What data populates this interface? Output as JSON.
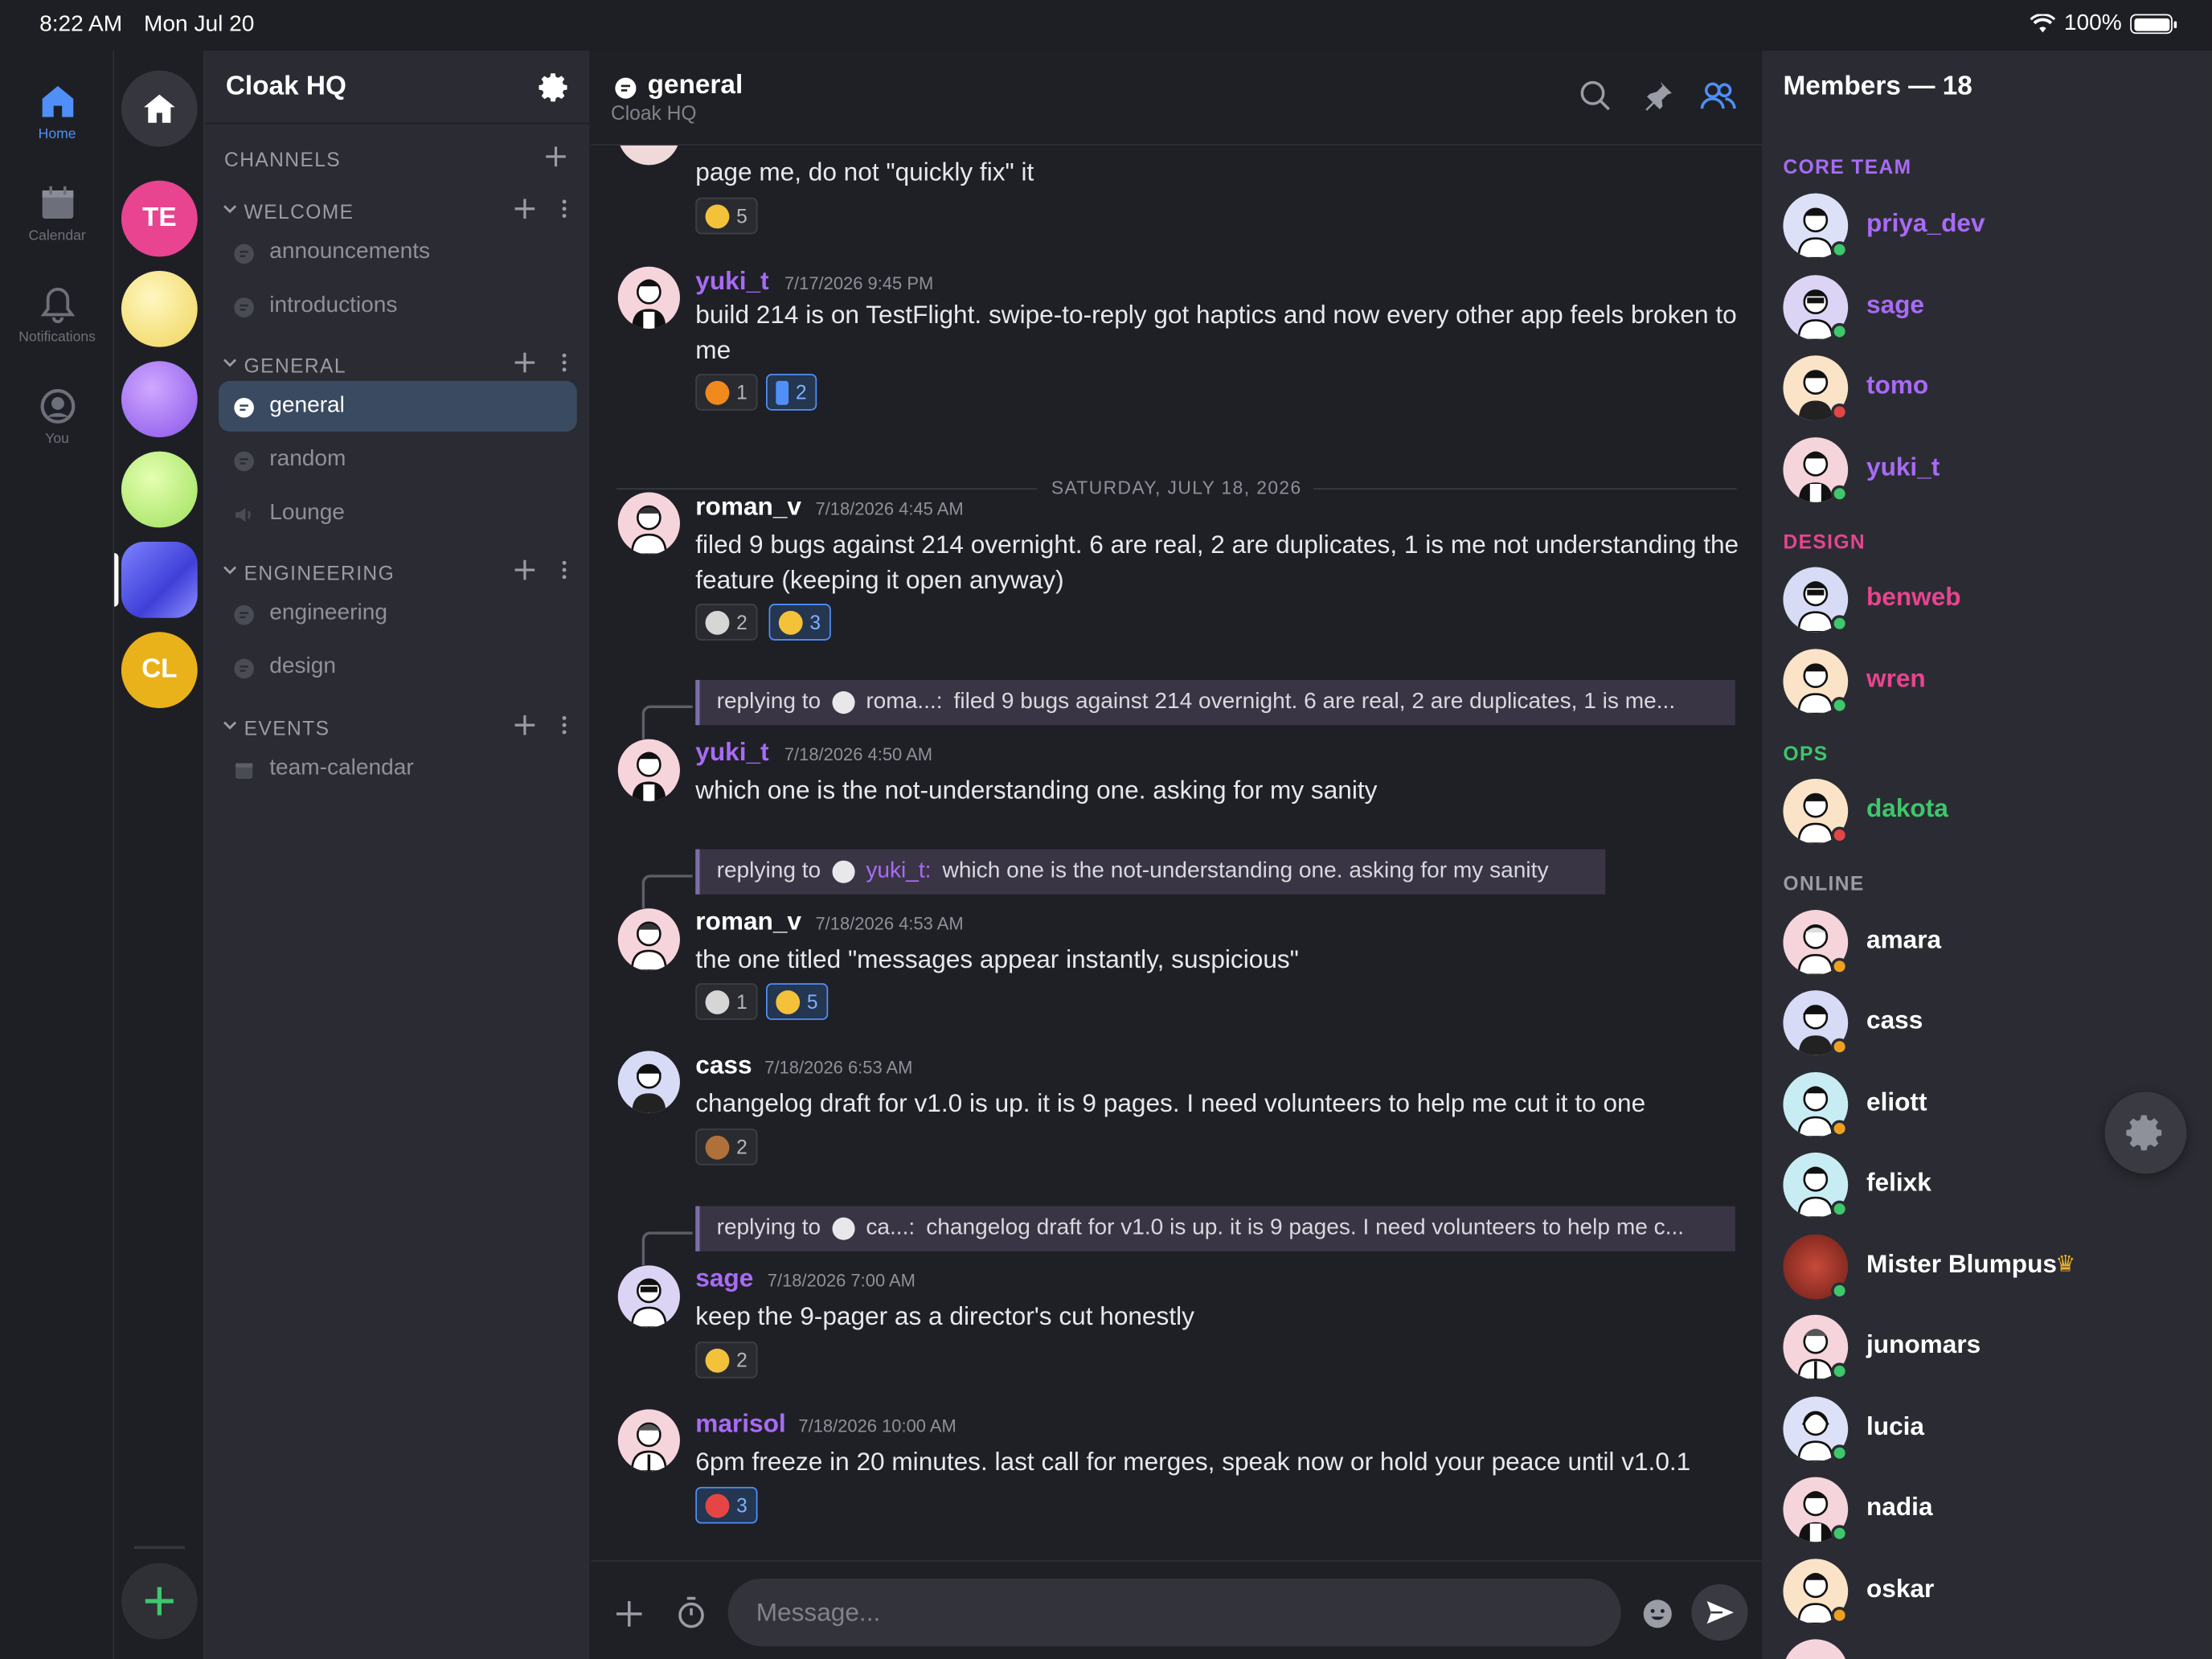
{
  "status_bar": {
    "time": "8:22 AM",
    "date": "Mon Jul 20",
    "battery": "100%"
  },
  "nav_rail": [
    {
      "label": "Home",
      "icon": "home-icon",
      "active": true
    },
    {
      "label": "Calendar",
      "icon": "calendar-icon",
      "active": false
    },
    {
      "label": "Notifications",
      "icon": "bell-icon",
      "active": false
    },
    {
      "label": "You",
      "icon": "user-circle-icon",
      "active": false
    }
  ],
  "servers": [
    {
      "initials": "TE",
      "color": "#e8448f"
    },
    {
      "initials": "",
      "color": "#f3e07a"
    },
    {
      "initials": "",
      "color": "#9b6cf0"
    },
    {
      "initials": "",
      "color": "#b9ec7b"
    },
    {
      "initials": "",
      "color": "#5a5cf0",
      "selected": true
    },
    {
      "initials": "CL",
      "color": "#e9b21a"
    }
  ],
  "sidebar": {
    "server_name": "Cloak HQ",
    "channels_label": "CHANNELS",
    "sections": [
      {
        "name": "WELCOME",
        "channels": [
          "announcements",
          "introductions"
        ]
      },
      {
        "name": "GENERAL",
        "channels": [
          "general",
          "random",
          "Lounge"
        ]
      },
      {
        "name": "ENGINEERING",
        "channels": [
          "engineering",
          "design"
        ]
      },
      {
        "name": "EVENTS",
        "channels": [
          "team-calendar"
        ]
      }
    ],
    "selected_channel": "general"
  },
  "chat": {
    "title": "general",
    "subtitle": "Cloak HQ",
    "partial_message": "page me, do not \"quickly fix\" it",
    "partial_reaction_count": "5",
    "date_divider": "SATURDAY, JULY 18, 2026",
    "messages": [
      {
        "author": "yuki_t",
        "timestamp": "7/17/2026 9:45 PM",
        "text": "build 214 is on TestFlight. swipe-to-reply got haptics and now every other app feels broken to me",
        "reactions": [
          "1",
          "2"
        ]
      },
      {
        "author": "roman_v",
        "timestamp": "7/18/2026 4:45 AM",
        "text": "filed 9 bugs against 214 overnight. 6 are real, 2 are duplicates, 1 is me not understanding the feature (keeping it open anyway)",
        "reactions": [
          "2",
          "3"
        ]
      },
      {
        "author": "yuki_t",
        "timestamp": "7/18/2026 4:50 AM",
        "text": "which one is the not-understanding one. asking for my sanity",
        "reply_prefix": "replying to",
        "reply_author": "roma...:",
        "reply_text": "filed 9 bugs against 214 overnight. 6 are real, 2 are duplicates, 1 is me..."
      },
      {
        "author": "roman_v",
        "timestamp": "7/18/2026 4:53 AM",
        "text": "the one titled \"messages appear instantly, suspicious\"",
        "reply_prefix": "replying to",
        "reply_author": "yuki_t:",
        "reply_text": "which one is the not-understanding one. asking for my sanity",
        "reactions": [
          "1",
          "5"
        ]
      },
      {
        "author": "cass",
        "timestamp": "7/18/2026 6:53 AM",
        "text": "changelog draft for v1.0 is up. it is 9 pages. I need volunteers to help me cut it to one",
        "reactions": [
          "2"
        ]
      },
      {
        "author": "sage",
        "timestamp": "7/18/2026 7:00 AM",
        "text": "keep the 9-pager as a director's cut honestly",
        "reply_prefix": "replying to",
        "reply_author": "ca...:",
        "reply_text": "changelog draft for v1.0 is up. it is 9 pages. I need volunteers to help me c...",
        "reactions": [
          "2"
        ]
      },
      {
        "author": "marisol",
        "timestamp": "7/18/2026 10:00 AM",
        "text": "6pm freeze in 20 minutes. last call for merges, speak now or hold your peace until v1.0.1",
        "reactions": [
          "3"
        ]
      }
    ],
    "composer_placeholder": "Message..."
  },
  "members": {
    "title": "Members — 18",
    "groups": [
      {
        "name": "CORE TEAM",
        "color": "#a86bf5",
        "members": [
          "priya_dev",
          "sage",
          "tomo",
          "yuki_t"
        ]
      },
      {
        "name": "DESIGN",
        "color": "#e8448f",
        "members": [
          "benweb",
          "wren"
        ]
      },
      {
        "name": "OPS",
        "color": "#3ec76b",
        "members": [
          "dakota"
        ]
      },
      {
        "name": "ONLINE",
        "color": "#9a9ca6",
        "members": [
          "amara",
          "cass",
          "eliott",
          "felixk",
          "Mister Blumpus",
          "junomars",
          "lucia",
          "nadia",
          "oskar"
        ]
      }
    ]
  }
}
